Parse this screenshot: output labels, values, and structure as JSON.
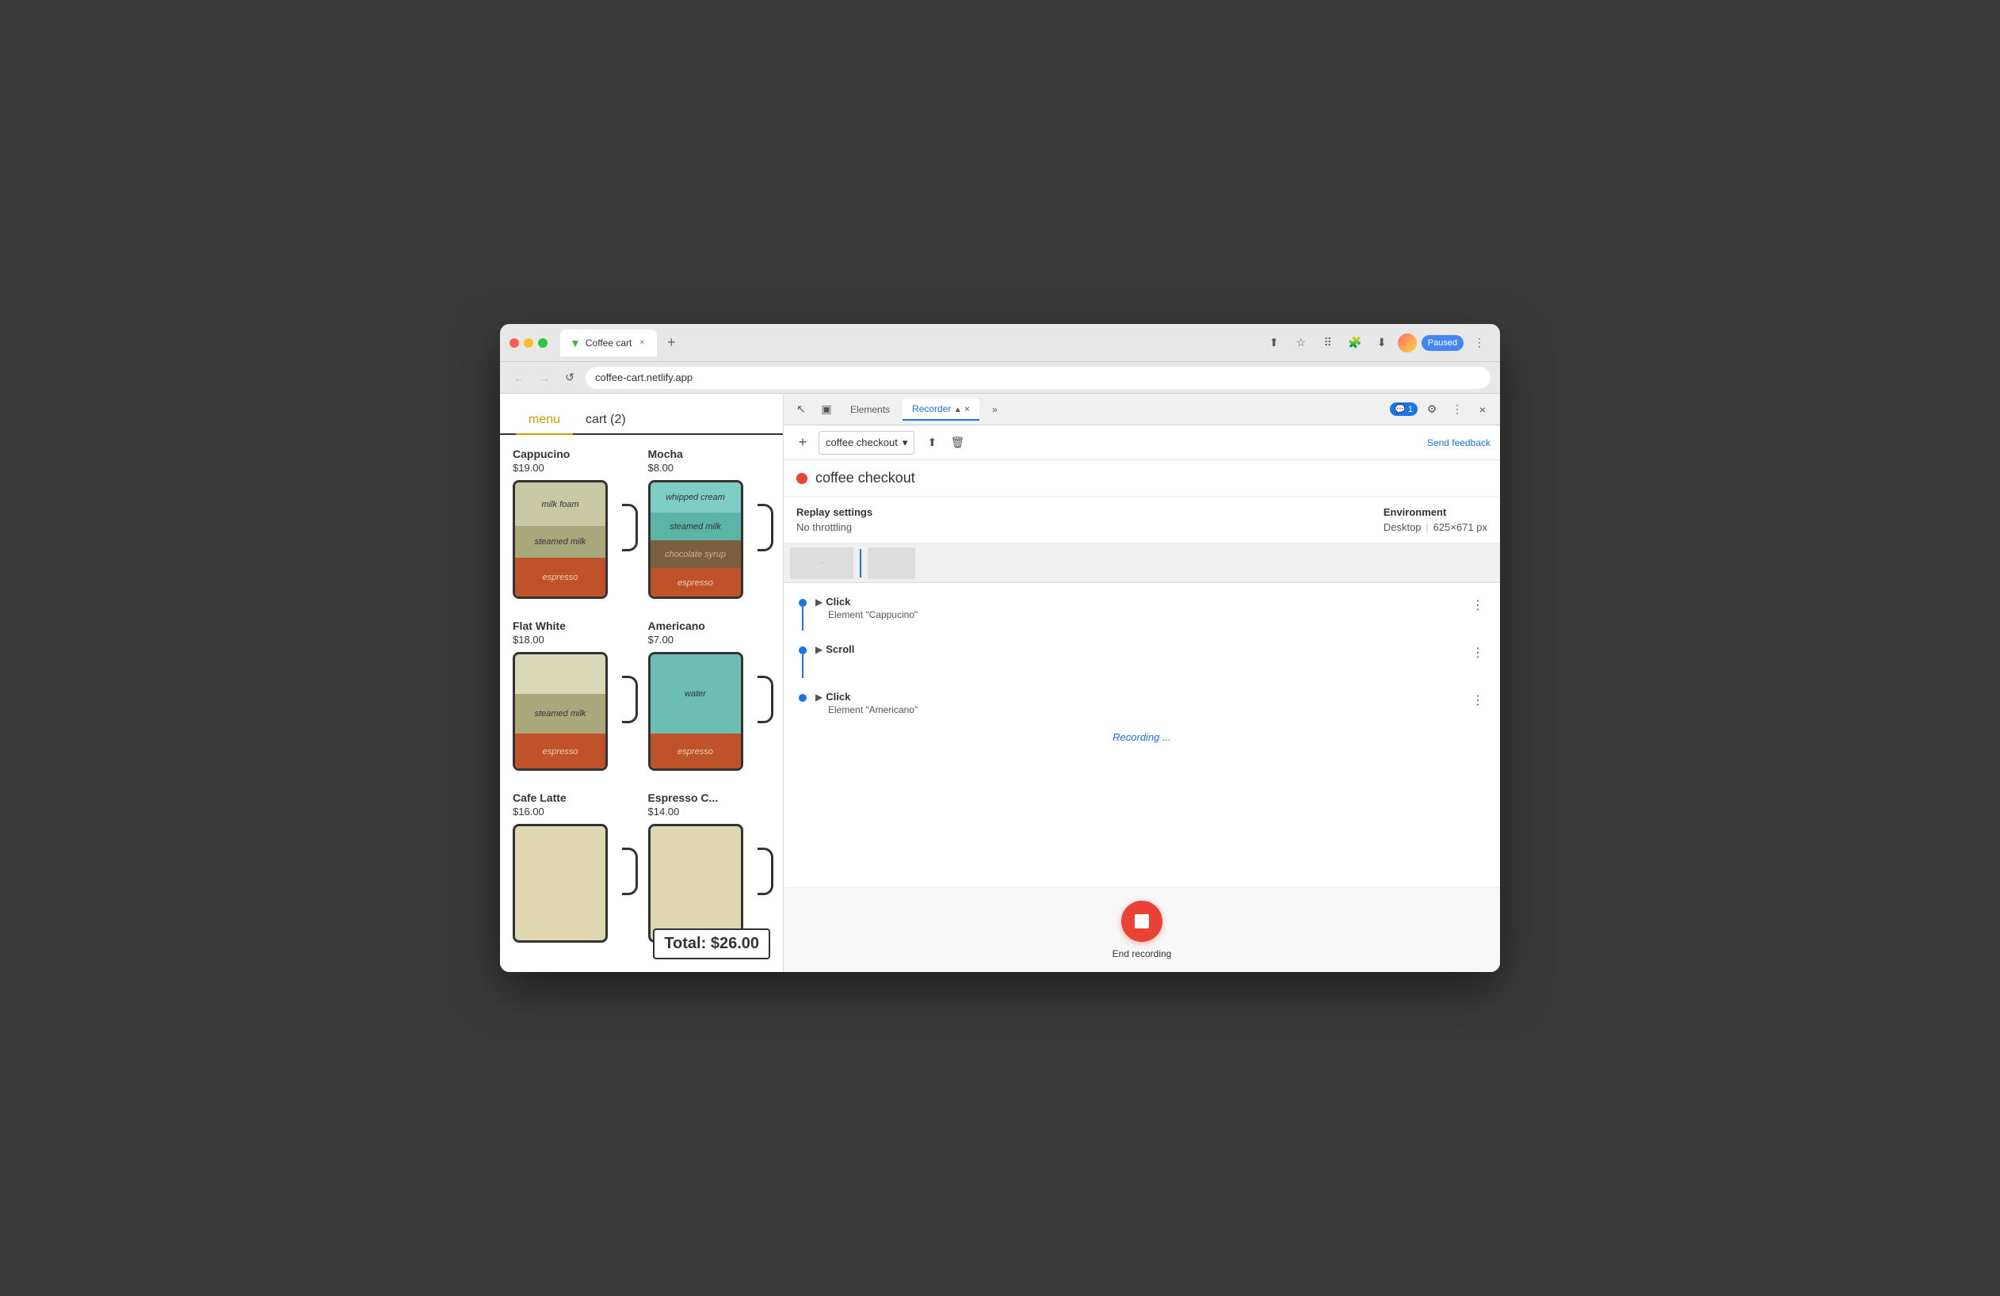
{
  "browser": {
    "title": "Coffee cart",
    "favicon": "▼",
    "url": "coffee-cart.netlify.app",
    "tab_close": "×",
    "tab_new": "+",
    "paused_label": "Paused",
    "controls": [
      "↑",
      "★",
      "⠿",
      "🔒",
      "⠿",
      "⠿"
    ]
  },
  "nav": {
    "back": "←",
    "forward": "→",
    "reload": "↺",
    "lock": "🔒"
  },
  "coffee_app": {
    "nav_menu": "menu",
    "nav_cart": "cart (2)",
    "items": [
      {
        "name": "Cappucino",
        "price": "$19.00",
        "layers": [
          {
            "label": "milk foam",
            "color": "#c8c9a4",
            "height": 55
          },
          {
            "label": "steamed milk",
            "color": "#a8a87a",
            "height": 40
          },
          {
            "label": "espresso",
            "color": "#c0522a",
            "height": 50
          }
        ]
      },
      {
        "name": "Mocha",
        "price": "$8.00",
        "layers": [
          {
            "label": "whipped cream",
            "color": "#7ecec4",
            "height": 38
          },
          {
            "label": "steamed milk",
            "color": "#5ab5a8",
            "height": 35
          },
          {
            "label": "chocolate syrup",
            "color": "#7a6040",
            "height": 35
          },
          {
            "label": "espresso",
            "color": "#c0522a",
            "height": 38
          }
        ]
      },
      {
        "name": "Flat White",
        "price": "$18.00",
        "layers": [
          {
            "label": "",
            "color": "#d8d8b8",
            "height": 55
          },
          {
            "label": "steamed milk",
            "color": "#a8a87a",
            "height": 45
          },
          {
            "label": "espresso",
            "color": "#c0522a",
            "height": 50
          }
        ]
      },
      {
        "name": "Americano",
        "price": "$7.00",
        "layers": [
          {
            "label": "water",
            "color": "#6bbdb5",
            "height": 100
          },
          {
            "label": "espresso",
            "color": "#c0522a",
            "height": 50
          }
        ]
      },
      {
        "name": "Cafe Latte",
        "price": "$16.00",
        "layers": []
      },
      {
        "name": "Espresso C...",
        "price": "$14.00",
        "layers": []
      }
    ],
    "total": "Total: $26.00"
  },
  "devtools": {
    "tabs": [
      "Elements",
      "Recorder",
      "»"
    ],
    "active_tab": "Recorder",
    "recorder_icon": "🎙",
    "active_icon": "▲",
    "close_tab": "×",
    "chat_badge": "💬 1",
    "settings_icon": "⚙",
    "more_icon": "⋮",
    "close_icon": "×",
    "toolbar": {
      "add_icon": "+",
      "dropdown_label": "coffee checkout",
      "dropdown_arrow": "▾",
      "upload_icon": "↑",
      "delete_icon": "🗑",
      "send_feedback": "Send feedback"
    },
    "recording": {
      "dot_color": "#ea4335",
      "title": "coffee checkout"
    },
    "replay_settings": {
      "label": "Replay settings",
      "throttling": "No throttling",
      "environment_label": "Environment",
      "environment": "Desktop",
      "separator": "|",
      "dimensions": "625×671 px"
    },
    "steps": [
      {
        "type": "Click",
        "detail": "Element \"Cappucino\"",
        "has_thumbnail": true,
        "dot_color": "#1a73e8"
      },
      {
        "type": "Scroll",
        "detail": "",
        "has_thumbnail": false,
        "dot_color": "#1a73e8"
      },
      {
        "type": "Click",
        "detail": "Element \"Americano\"",
        "has_thumbnail": false,
        "dot_color": "#1a73e8"
      }
    ],
    "recording_status": "Recording ...",
    "end_recording_label": "End recording"
  }
}
